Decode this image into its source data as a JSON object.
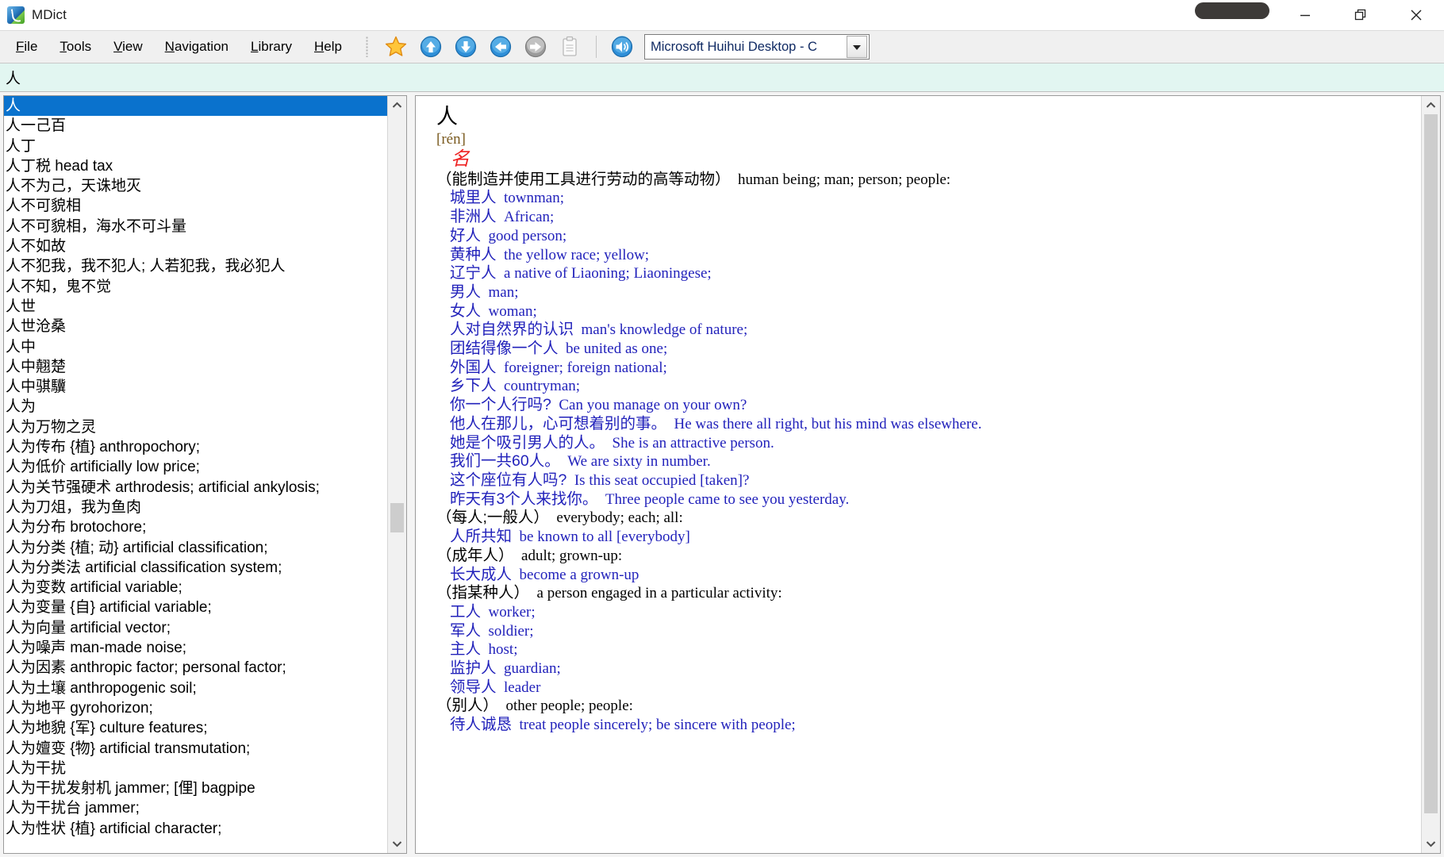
{
  "window": {
    "title": "MDict",
    "icon": "mdict-app-icon",
    "controls": {
      "minimize": "minimize-icon",
      "restore": "restore-icon",
      "close": "close-icon"
    }
  },
  "menubar": {
    "items": [
      {
        "name": "file",
        "label": "File",
        "accel": "F"
      },
      {
        "name": "tools",
        "label": "Tools",
        "accel": "T"
      },
      {
        "name": "view",
        "label": "View",
        "accel": "V"
      },
      {
        "name": "navigation",
        "label": "Navigation",
        "accel": "N"
      },
      {
        "name": "library",
        "label": "Library",
        "accel": "L"
      },
      {
        "name": "help",
        "label": "Help",
        "accel": "H"
      }
    ]
  },
  "toolbar": {
    "buttons": [
      {
        "name": "favorites-button",
        "icon": "star-icon",
        "enabled": true
      },
      {
        "name": "scroll-up-button",
        "icon": "arrow-up-icon",
        "enabled": true
      },
      {
        "name": "scroll-down-button",
        "icon": "arrow-down-icon",
        "enabled": true
      },
      {
        "name": "back-button",
        "icon": "arrow-back-icon",
        "enabled": true
      },
      {
        "name": "forward-button",
        "icon": "arrow-forward-icon",
        "enabled": false
      },
      {
        "name": "copy-button",
        "icon": "clipboard-icon",
        "enabled": false
      },
      {
        "name": "speak-button",
        "icon": "speaker-icon",
        "enabled": true
      }
    ],
    "voice_select": {
      "value": "Microsoft Huihui Desktop - C",
      "arrow": "chevron-down-icon"
    }
  },
  "search": {
    "value": "人",
    "placeholder": ""
  },
  "wordlist": {
    "selected_index": 0,
    "items": [
      "人",
      "人一己百",
      "人丁",
      "人丁税 head tax",
      "人不为己，天诛地灭",
      "人不可貌相",
      "人不可貌相，海水不可斗量",
      "人不如故",
      "人不犯我，我不犯人; 人若犯我，我必犯人",
      "人不知，鬼不觉",
      "人世",
      "人世沧桑",
      "人中",
      "人中翹楚",
      "人中骐驥",
      "人为",
      "人为万物之灵",
      "人为传布 {植} anthropochory;",
      "人为低价 artificially low price;",
      "人为关节强硬术 arthrodesis; artificial ankylosis;",
      "人为刀俎，我为鱼肉",
      "人为分布 brotochore;",
      "人为分类 {植; 动} artificial classification;",
      "人为分类法 artificial classification system;",
      "人为变数 artificial variable;",
      "人为变量 {自} artificial variable;",
      "人为向量 artificial vector;",
      "人为噪声 man-made noise;",
      "人为因素 anthropic factor; personal factor;",
      "人为土壤 anthropogenic soil;",
      "人为地平 gyrohorizon;",
      "人为地貌 {军} culture features;",
      "人为嬗变 {物} artificial transmutation;",
      "人为干扰",
      "人为干扰发射机 jammer; [俚] bagpipe",
      "人为干扰台 jammer;",
      "人为性状 {植} artificial character;"
    ]
  },
  "definition": {
    "headword": "人",
    "pinyin": "[rén]",
    "part_of_speech": "名",
    "lines": [
      {
        "kind": "sense",
        "cn": "（能制造并使用工具进行劳动的高等动物）",
        "en": "human being; man; person; people:"
      },
      {
        "kind": "ex",
        "cn": "城里人",
        "en": "townman;"
      },
      {
        "kind": "ex",
        "cn": "非洲人",
        "en": "African;"
      },
      {
        "kind": "ex",
        "cn": "好人",
        "en": "good person;"
      },
      {
        "kind": "ex",
        "cn": "黄种人",
        "en": "the yellow race; yellow;"
      },
      {
        "kind": "ex",
        "cn": "辽宁人",
        "en": "a native of Liaoning; Liaoningese;"
      },
      {
        "kind": "ex",
        "cn": "男人",
        "en": "man;"
      },
      {
        "kind": "ex",
        "cn": "女人",
        "en": "woman;"
      },
      {
        "kind": "ex",
        "cn": "人对自然界的认识",
        "en": "man's knowledge of nature;"
      },
      {
        "kind": "ex",
        "cn": "团结得像一个人",
        "en": "be united as one;"
      },
      {
        "kind": "ex",
        "cn": "外国人",
        "en": "foreigner; foreign national;"
      },
      {
        "kind": "ex",
        "cn": "乡下人",
        "en": "countryman;"
      },
      {
        "kind": "ex",
        "cn": "你一个人行吗?",
        "en": "Can you manage on your own?"
      },
      {
        "kind": "ex",
        "cn": "他人在那儿，心可想着别的事。",
        "en": "He was there all right, but his mind was elsewhere."
      },
      {
        "kind": "ex",
        "cn": "她是个吸引男人的人。",
        "en": "She is an attractive person."
      },
      {
        "kind": "ex",
        "cn": "我们一共60人。",
        "en": "We are sixty in number."
      },
      {
        "kind": "ex",
        "cn": "这个座位有人吗?",
        "en": "Is this seat occupied [taken]?"
      },
      {
        "kind": "ex",
        "cn": "昨天有3个人来找你。",
        "en": "Three people came to see you yesterday."
      },
      {
        "kind": "sense",
        "cn": "（每人;一般人）",
        "en": "everybody; each; all:"
      },
      {
        "kind": "ex",
        "cn": "人所共知",
        "en": "be known to all [everybody]"
      },
      {
        "kind": "sense",
        "cn": "（成年人）",
        "en": "adult; grown-up:"
      },
      {
        "kind": "ex",
        "cn": "长大成人",
        "en": "become a grown-up"
      },
      {
        "kind": "sense",
        "cn": "（指某种人）",
        "en": "a person engaged in a particular activity:"
      },
      {
        "kind": "ex",
        "cn": "工人",
        "en": "worker;"
      },
      {
        "kind": "ex",
        "cn": "军人",
        "en": "soldier;"
      },
      {
        "kind": "ex",
        "cn": "主人",
        "en": "host;"
      },
      {
        "kind": "ex",
        "cn": "监护人",
        "en": "guardian;"
      },
      {
        "kind": "ex",
        "cn": "领导人",
        "en": "leader"
      },
      {
        "kind": "sense",
        "cn": "（别人）",
        "en": "other people; people:"
      },
      {
        "kind": "ex",
        "cn": "待人诚恳",
        "en": "treat people sincerely; be sincere with people;"
      }
    ]
  },
  "scrollbars": {
    "left": {
      "up_icon": "chevron-up-icon",
      "down_icon": "chevron-down-icon",
      "thumb_top_pct": 54,
      "thumb_height_pct": 4
    },
    "right": {
      "up_icon": "chevron-up-icon",
      "down_icon": "chevron-down-icon",
      "thumb_top_pct": 0,
      "thumb_height_pct": 97
    }
  },
  "colors": {
    "selection": "#0a72cd",
    "search_background": "#e2f6f1",
    "example_blue": "#2222bb",
    "pos_red": "#ee2222",
    "pinyin_brown": "#7a5a1f"
  }
}
